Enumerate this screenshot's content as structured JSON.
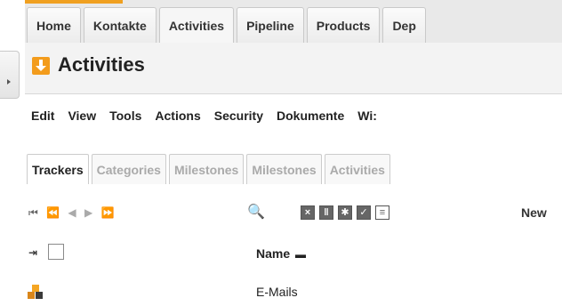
{
  "top_tabs": [
    {
      "label": "Home"
    },
    {
      "label": "Kontakte"
    },
    {
      "label": "Activities"
    },
    {
      "label": "Pipeline"
    },
    {
      "label": "Products"
    },
    {
      "label": "Dep"
    }
  ],
  "page": {
    "title": "Activities"
  },
  "menu": [
    {
      "label": "Edit"
    },
    {
      "label": "View"
    },
    {
      "label": "Tools"
    },
    {
      "label": "Actions"
    },
    {
      "label": "Security"
    },
    {
      "label": "Dokumente"
    },
    {
      "label": "Wi:"
    }
  ],
  "sub_tabs": [
    {
      "label": "Trackers"
    },
    {
      "label": "Categories"
    },
    {
      "label": "Milestones"
    },
    {
      "label": "Milestones"
    },
    {
      "label": "Activities"
    }
  ],
  "toolbar": {
    "nav_first": "⏮",
    "nav_rest": "⏪ ◀ ▶ ⏩",
    "new_label": "New",
    "search_glyph": "🔍"
  },
  "grid": {
    "column_toggle": "⇥",
    "columns": {
      "name": "Name",
      "sort_mark": "▬"
    },
    "rows": [
      {
        "name": "E-Mails"
      }
    ]
  },
  "colors": {
    "accent": "#f0a020",
    "title_icon": "#f39c1c"
  }
}
